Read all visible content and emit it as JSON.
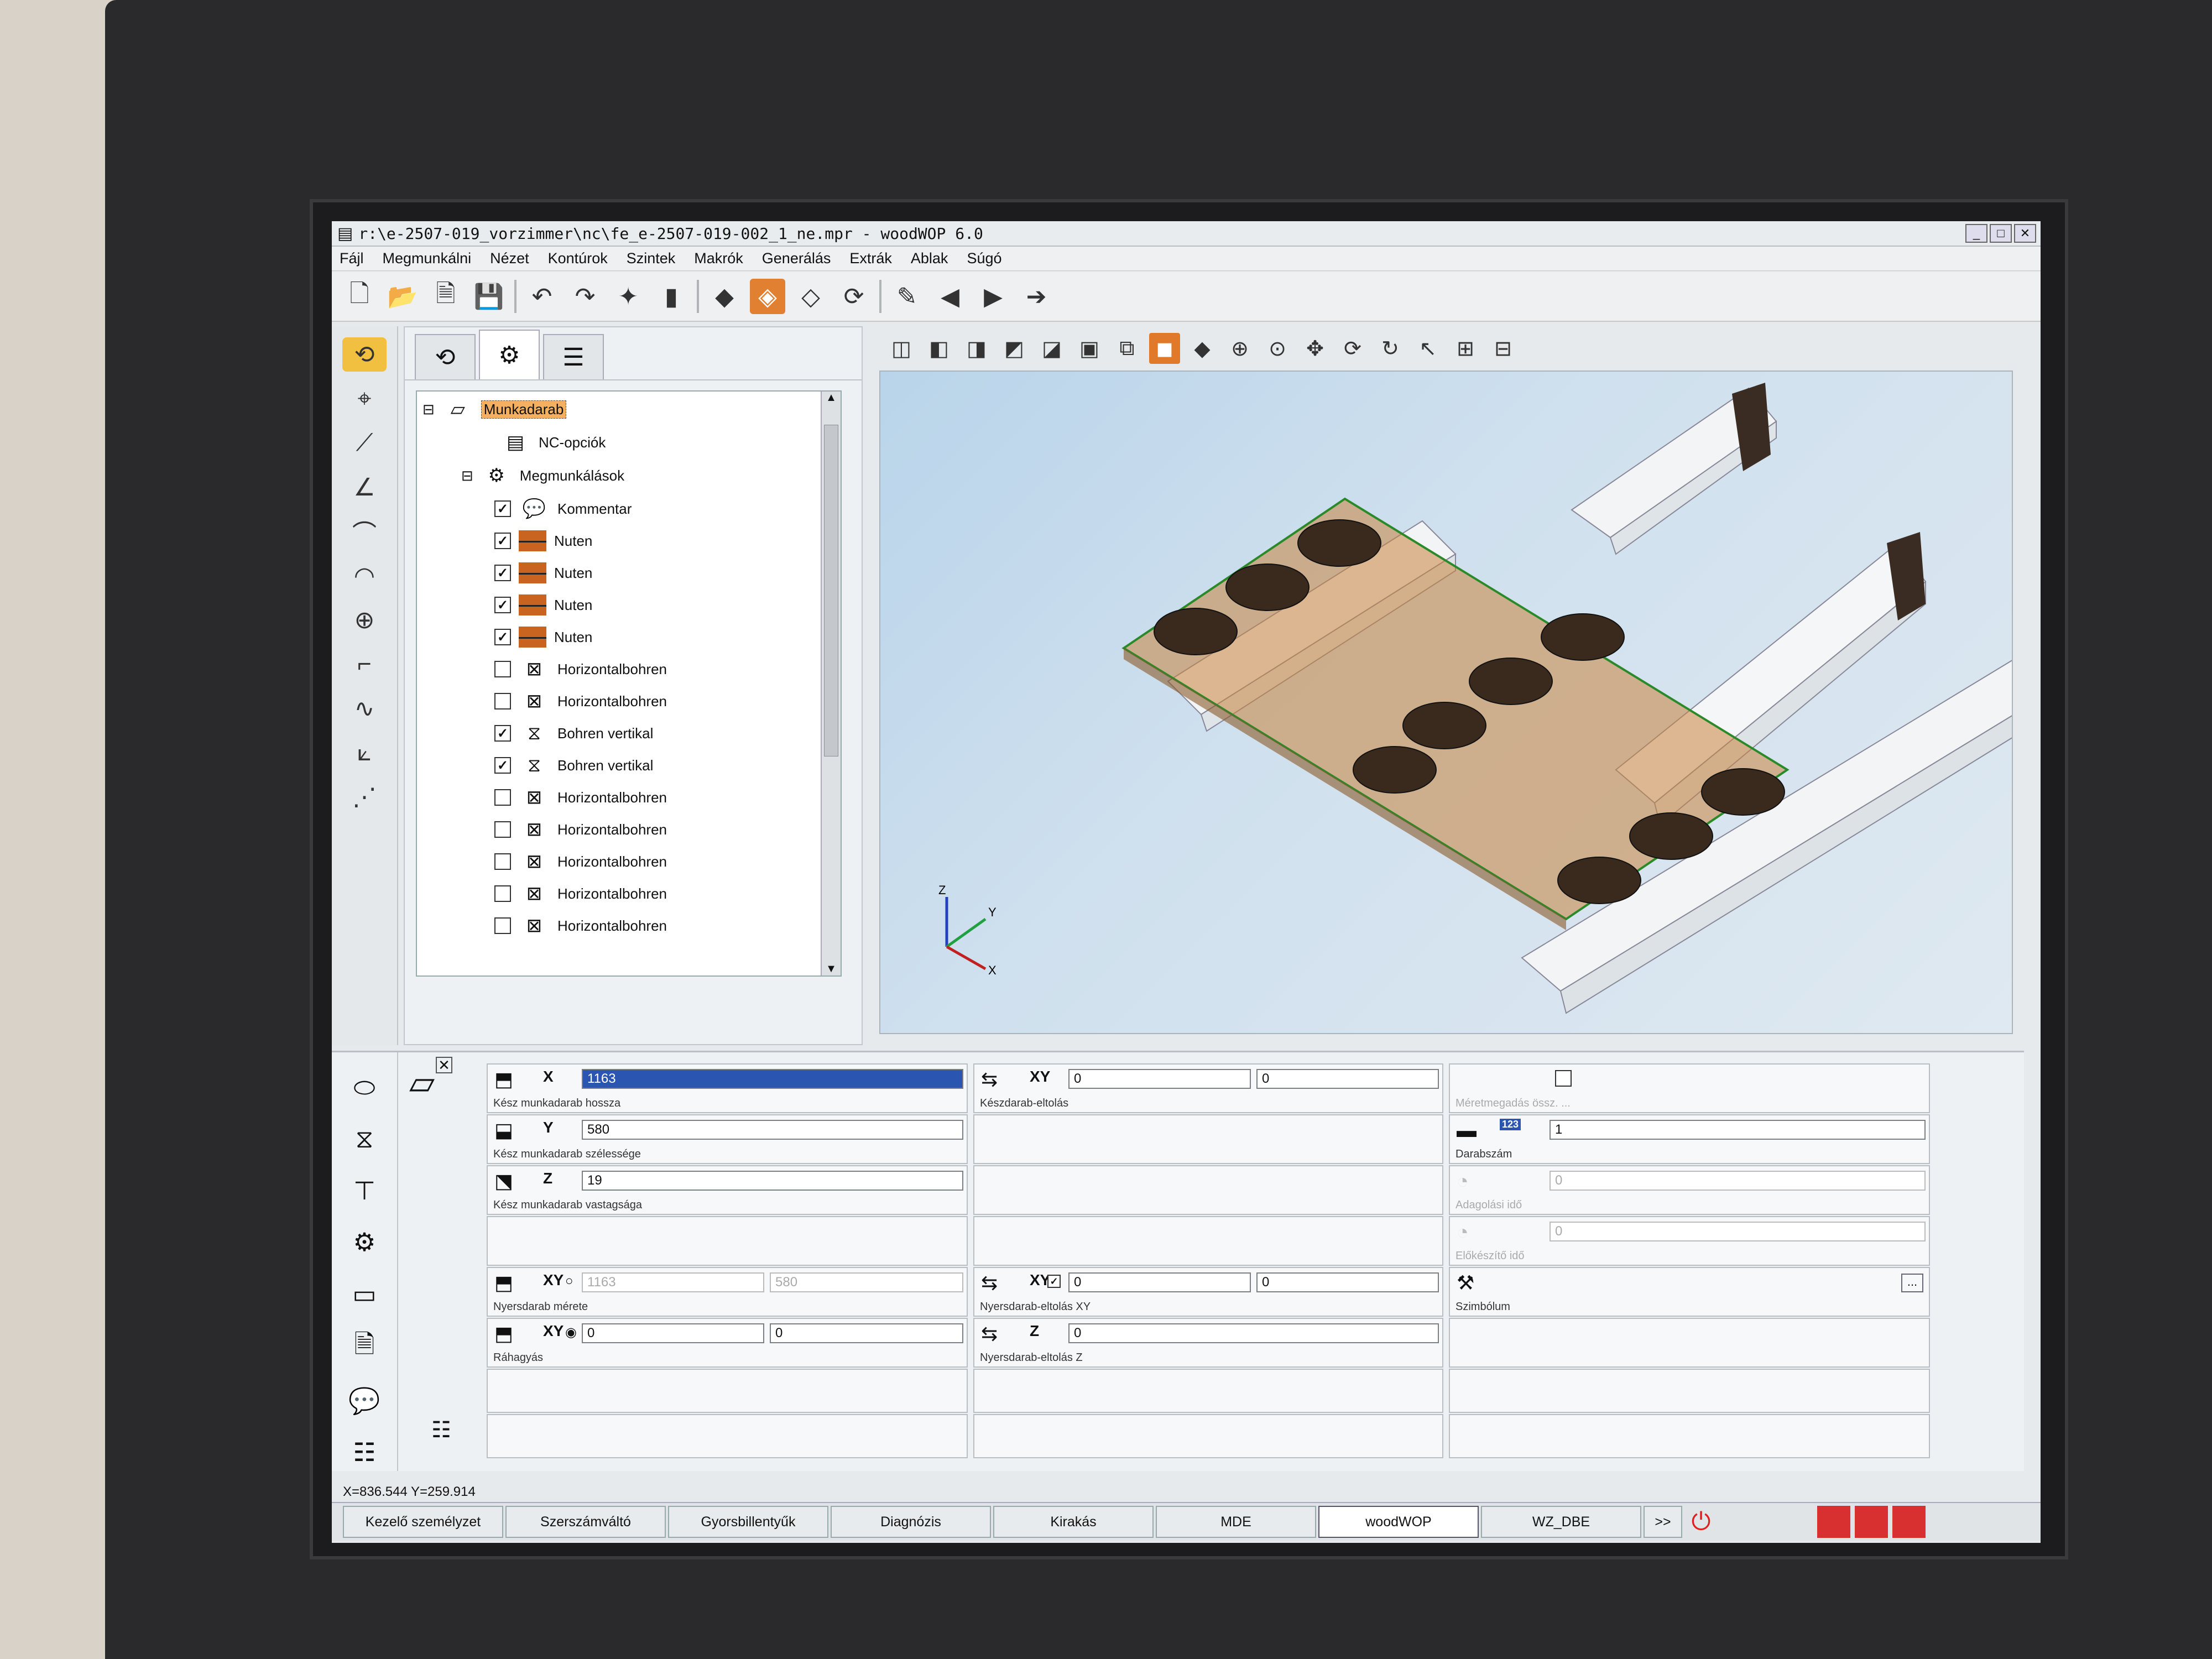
{
  "window": {
    "title": "r:\\e-2507-019_vorzimmer\\nc\\fe_e-2507-019-002_1_ne.mpr - woodWOP 6.0"
  },
  "menu": [
    "Fájl",
    "Megmunkálni",
    "Nézet",
    "Kontúrok",
    "Szintek",
    "Makrók",
    "Generálás",
    "Extrák",
    "Ablak",
    "Súgó"
  ],
  "tree": {
    "root": "Munkadarab",
    "nc_options": "NC-opciók",
    "operations": "Megmunkálások",
    "items": [
      {
        "label": "Kommentar",
        "checked": true,
        "icon": "comment-icon"
      },
      {
        "label": "Nuten",
        "checked": true,
        "icon": "groove-icon"
      },
      {
        "label": "Nuten",
        "checked": true,
        "icon": "groove-icon"
      },
      {
        "label": "Nuten",
        "checked": true,
        "icon": "groove-icon"
      },
      {
        "label": "Nuten",
        "checked": true,
        "icon": "groove-icon"
      },
      {
        "label": "Horizontalbohren",
        "checked": false,
        "icon": "horizontal-drill-icon"
      },
      {
        "label": "Horizontalbohren",
        "checked": false,
        "icon": "horizontal-drill-icon"
      },
      {
        "label": "Bohren vertikal",
        "checked": true,
        "icon": "vertical-drill-icon"
      },
      {
        "label": "Bohren vertikal",
        "checked": true,
        "icon": "vertical-drill-icon"
      },
      {
        "label": "Horizontalbohren",
        "checked": false,
        "icon": "horizontal-drill-icon"
      },
      {
        "label": "Horizontalbohren",
        "checked": false,
        "icon": "horizontal-drill-icon"
      },
      {
        "label": "Horizontalbohren",
        "checked": false,
        "icon": "horizontal-drill-icon"
      },
      {
        "label": "Horizontalbohren",
        "checked": false,
        "icon": "horizontal-drill-icon"
      },
      {
        "label": "Horizontalbohren",
        "checked": false,
        "icon": "horizontal-drill-icon"
      }
    ]
  },
  "props": {
    "x": {
      "axis": "X",
      "value": "1163",
      "label": "Kész munkadarab hossza"
    },
    "y": {
      "axis": "Y",
      "value": "580",
      "label": "Kész munkadarab szélessége"
    },
    "z": {
      "axis": "Z",
      "value": "19",
      "label": "Kész munkadarab vastagsága"
    },
    "offset": {
      "axis": "XY",
      "v1": "0",
      "v2": "0",
      "label": "Készdarab-eltolás"
    },
    "meas": {
      "label": "Méretmegadás össz. ...",
      "checked": false
    },
    "count": {
      "value": "1",
      "label": "Darabszám",
      "badge": "123"
    },
    "feed": {
      "value": "0",
      "label": "Adagolási idő"
    },
    "setup": {
      "value": "0",
      "label": "Előkészítő idő"
    },
    "raw": {
      "axis": "XY",
      "v1": "1163",
      "v2": "580",
      "label": "Nyersdarab mérete"
    },
    "rawoff_xy": {
      "axis": "XY",
      "v1": "0",
      "v2": "0",
      "label": "Nyersdarab-eltolás XY"
    },
    "symbol": {
      "label": "Szimbólum",
      "btn": "..."
    },
    "allow": {
      "axis": "XY",
      "v1": "0",
      "v2": "0",
      "label": "Ráhagyás"
    },
    "rawoff_z": {
      "axis": "Z",
      "value": "0",
      "label": "Nyersdarab-eltolás Z"
    }
  },
  "status": "X=836.544 Y=259.914",
  "taskbar": [
    "Kezelő személyzet",
    "Szerszámváltó",
    "Gyorsbillentyűk",
    "Diagnózis",
    "Kirakás",
    "MDE",
    "woodWOP",
    "WZ_DBE"
  ],
  "taskbar_more": ">>",
  "axes3d": {
    "x": "X",
    "y": "Y",
    "z": "Z"
  },
  "colors": {
    "accent": "#e08030",
    "selection": "#2a55b0",
    "board": "#c8843c"
  }
}
